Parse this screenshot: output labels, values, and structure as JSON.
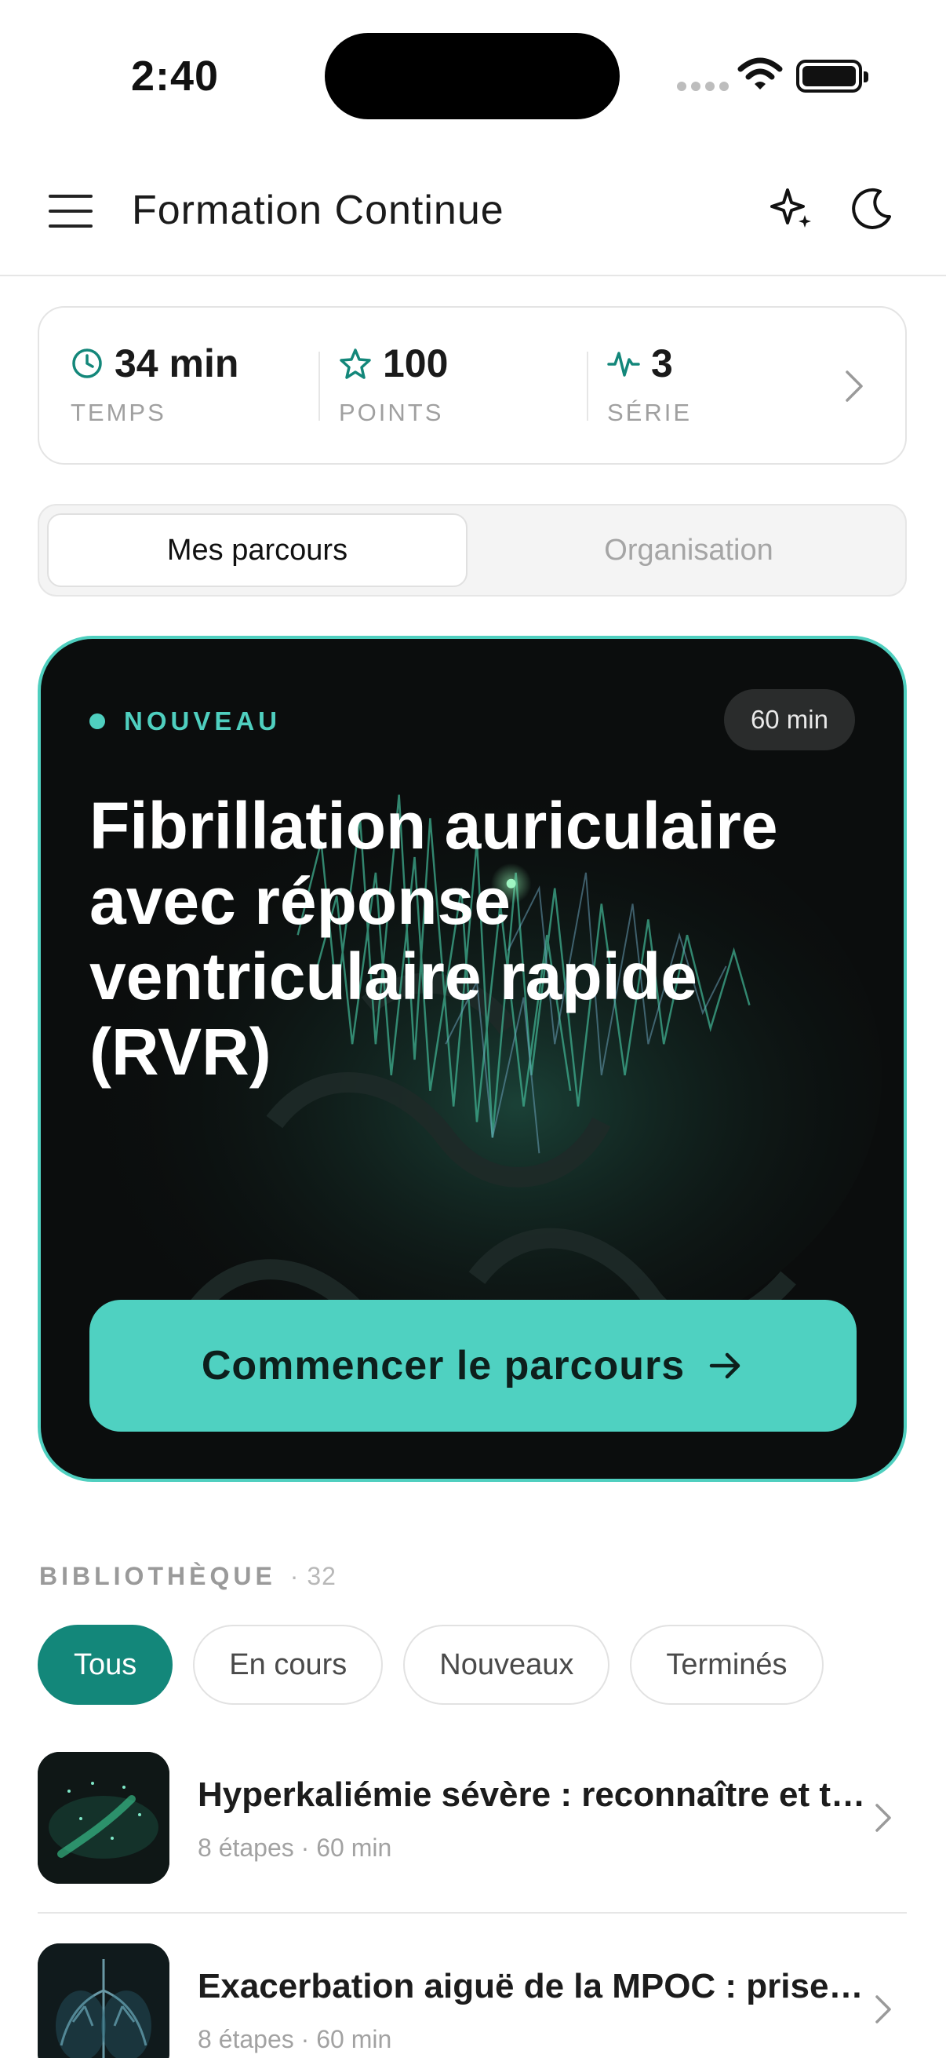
{
  "status_bar": {
    "time": "2:40"
  },
  "header": {
    "title": "Formation Continue"
  },
  "stats": [
    {
      "value": "34 min",
      "label": "TEMPS",
      "icon": "clock-icon"
    },
    {
      "value": "100",
      "label": "POINTS",
      "icon": "star-icon"
    },
    {
      "value": "3",
      "label": "SÉRIE",
      "icon": "activity-icon"
    }
  ],
  "tabs": {
    "active": "Mes parcours",
    "inactive": "Organisation"
  },
  "hero": {
    "badge": "NOUVEAU",
    "duration": "60 min",
    "title": "Fibrillation auriculaire avec réponse ventriculaire rapide (RVR)",
    "cta": "Commencer le parcours"
  },
  "library": {
    "heading": "BIBLIOTHÈQUE",
    "count": "· 32",
    "filters": [
      "Tous",
      "En cours",
      "Nouveaux",
      "Terminés"
    ],
    "items": [
      {
        "title": "Hyperkaliémie sévère : reconnaître et traiter",
        "meta": "8 étapes · 60 min"
      },
      {
        "title": "Exacerbation aiguë de la MPOC : prise en charge",
        "meta": "8 étapes · 60 min"
      }
    ]
  },
  "colors": {
    "accent": "#4fcfbf",
    "chip_active": "#13877a",
    "hero_bg": "#0b0d0d"
  }
}
